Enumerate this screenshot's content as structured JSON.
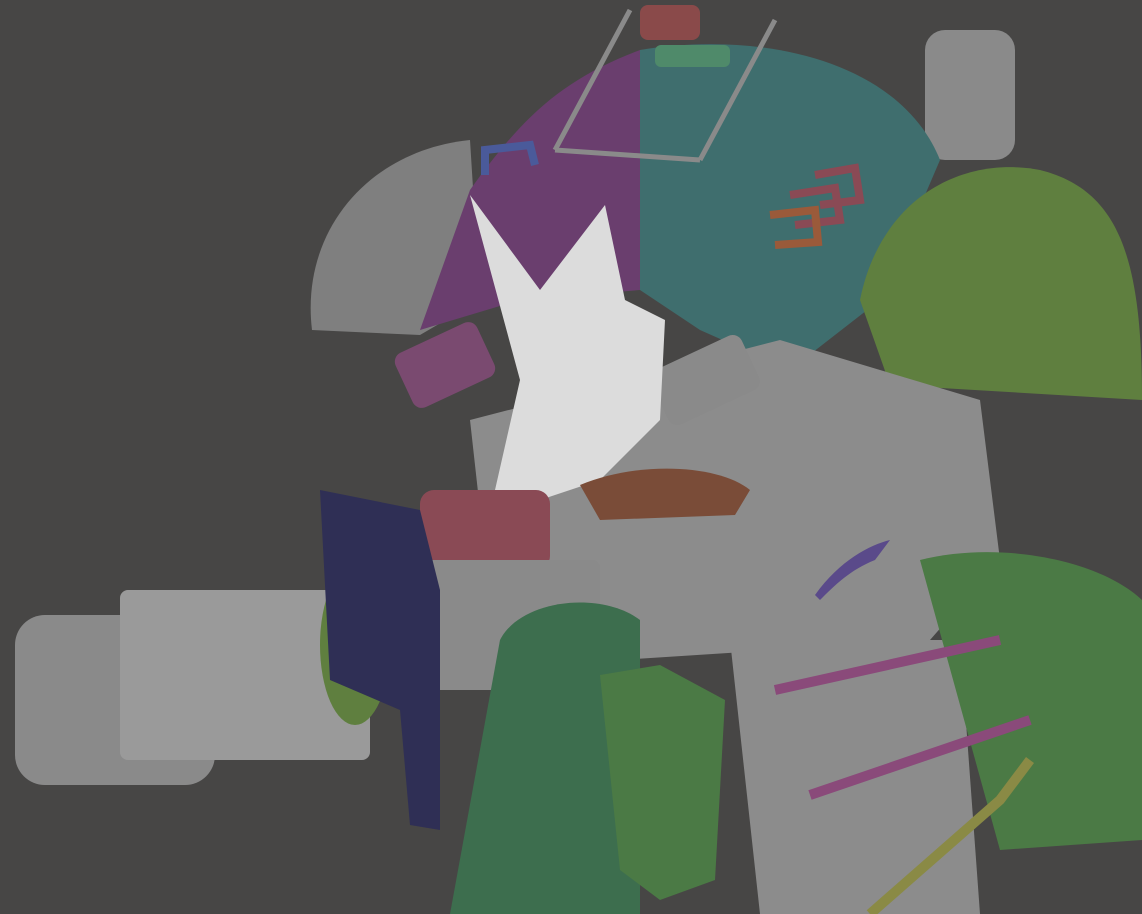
{
  "viewport": {
    "background": "#474645"
  },
  "palette": {
    "grey": "#8c8c8c",
    "grey_dark": "#6a6a6a",
    "grey_light": "#b0b0b0",
    "purple": "#6a3e6e",
    "teal": "#3f6e6e",
    "green": "#5f7f3f",
    "dark_green": "#3d6e4e",
    "armor_green": "#4b7a45",
    "navy": "#2f2f55",
    "red": "#8a4a4a",
    "brown": "#7a4c38",
    "magenta": "#8a4a7a",
    "white": "#e6e6e6",
    "olive": "#8a8a45",
    "blue": "#4a5a9a"
  }
}
